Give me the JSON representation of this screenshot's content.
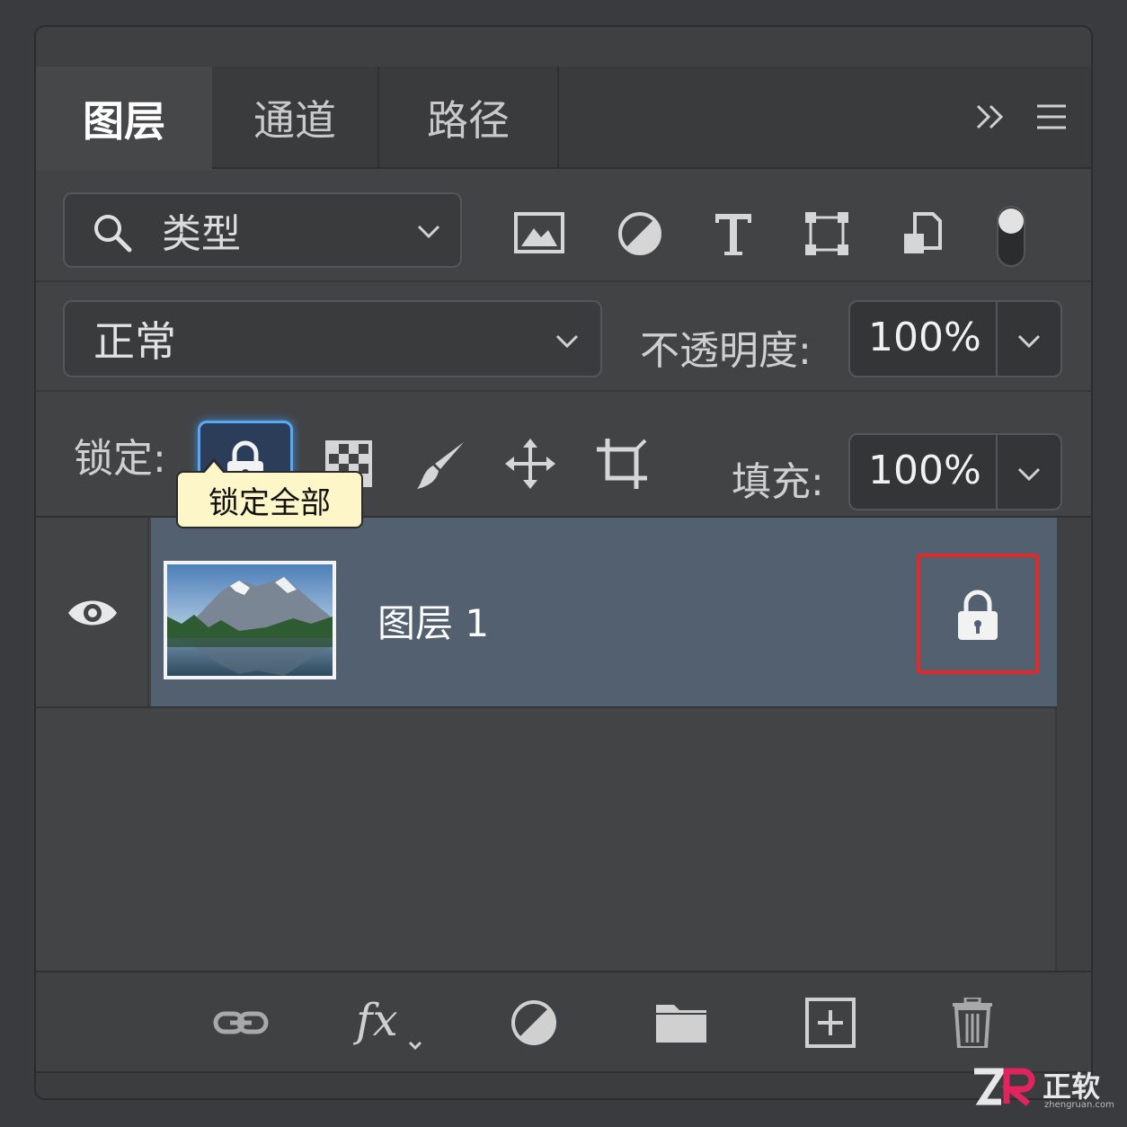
{
  "tabs": [
    {
      "label": "图层",
      "active": true
    },
    {
      "label": "通道",
      "active": false
    },
    {
      "label": "路径",
      "active": false
    }
  ],
  "filter": {
    "kind_label": "类型",
    "icons": [
      "image-filter-icon",
      "adjustment-filter-icon",
      "type-filter-icon",
      "shape-filter-icon",
      "smart-object-filter-icon",
      "filter-toggle-icon"
    ]
  },
  "blend": {
    "mode": "正常",
    "opacity_label": "不透明度:",
    "opacity_value": "100%"
  },
  "lock": {
    "label": "锁定:",
    "fill_label": "填充:",
    "fill_value": "100%",
    "tooltip": "锁定全部"
  },
  "layers": [
    {
      "name": "图层 1",
      "visible": true,
      "locked": true
    }
  ],
  "watermark": {
    "brand": "正软",
    "sub": "zhengruan.com"
  },
  "colors": {
    "selected_layer": "#52606f",
    "highlight": "#e02a2a",
    "focus": "#5aa8f0"
  }
}
